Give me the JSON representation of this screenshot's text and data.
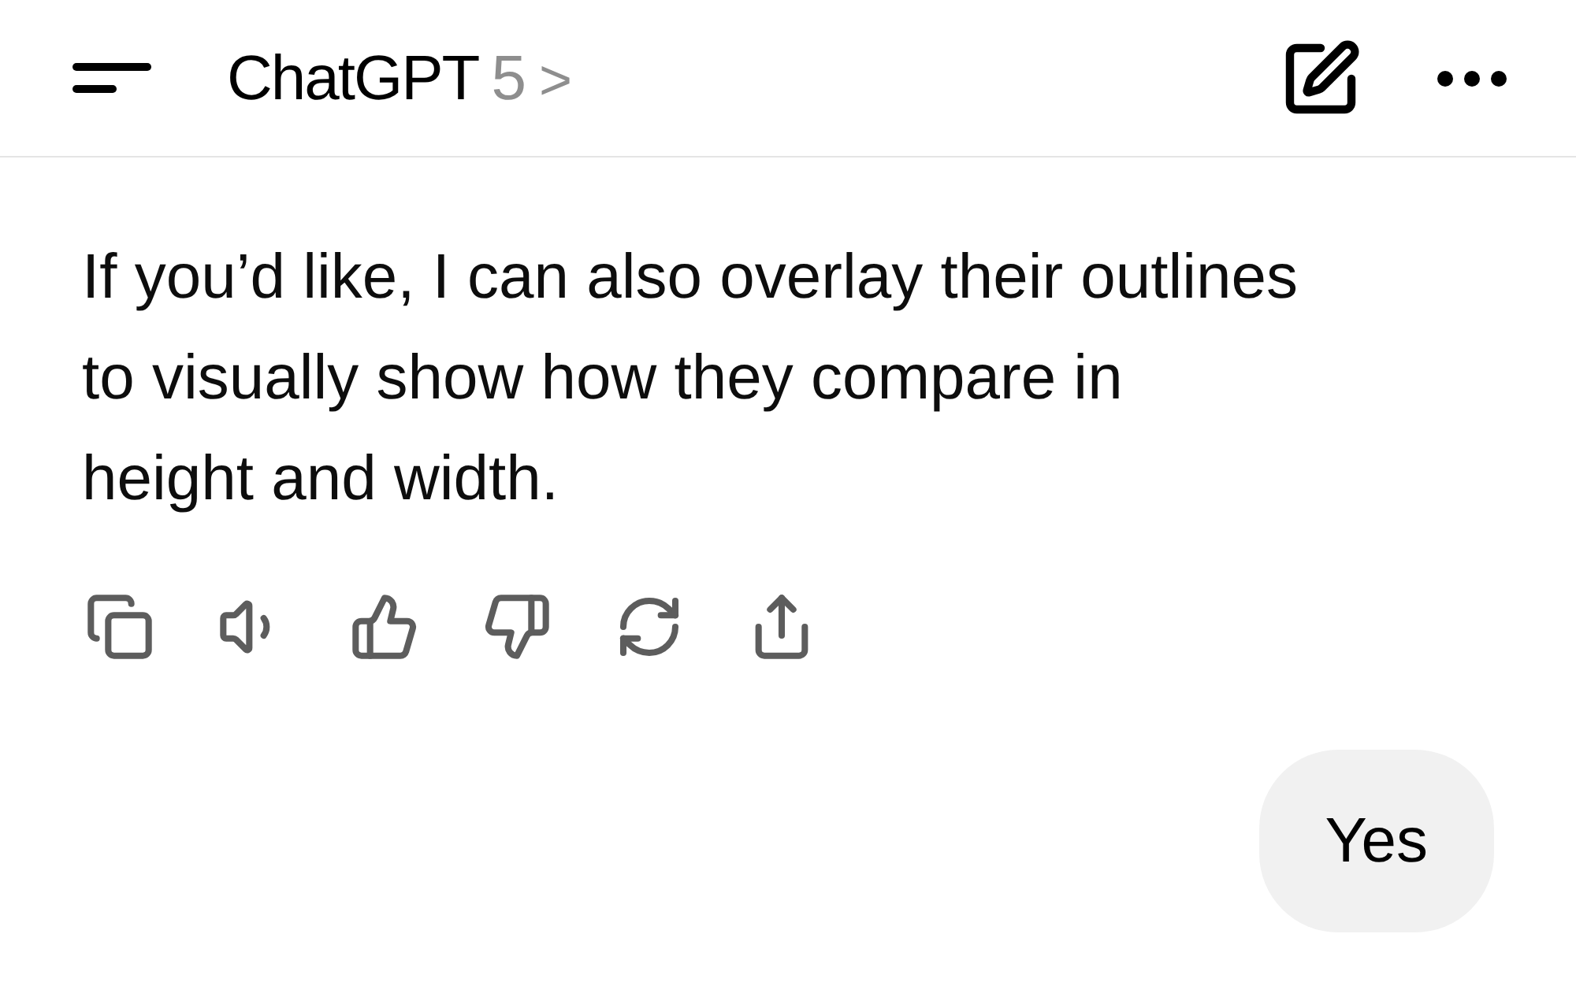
{
  "header": {
    "title": "ChatGPT",
    "model": "5",
    "chevron": ">"
  },
  "assistant_message": {
    "text": "If you’d like, I can also overlay their outlines to visually show how they compare in height and width."
  },
  "user_message": {
    "text": "Yes"
  }
}
